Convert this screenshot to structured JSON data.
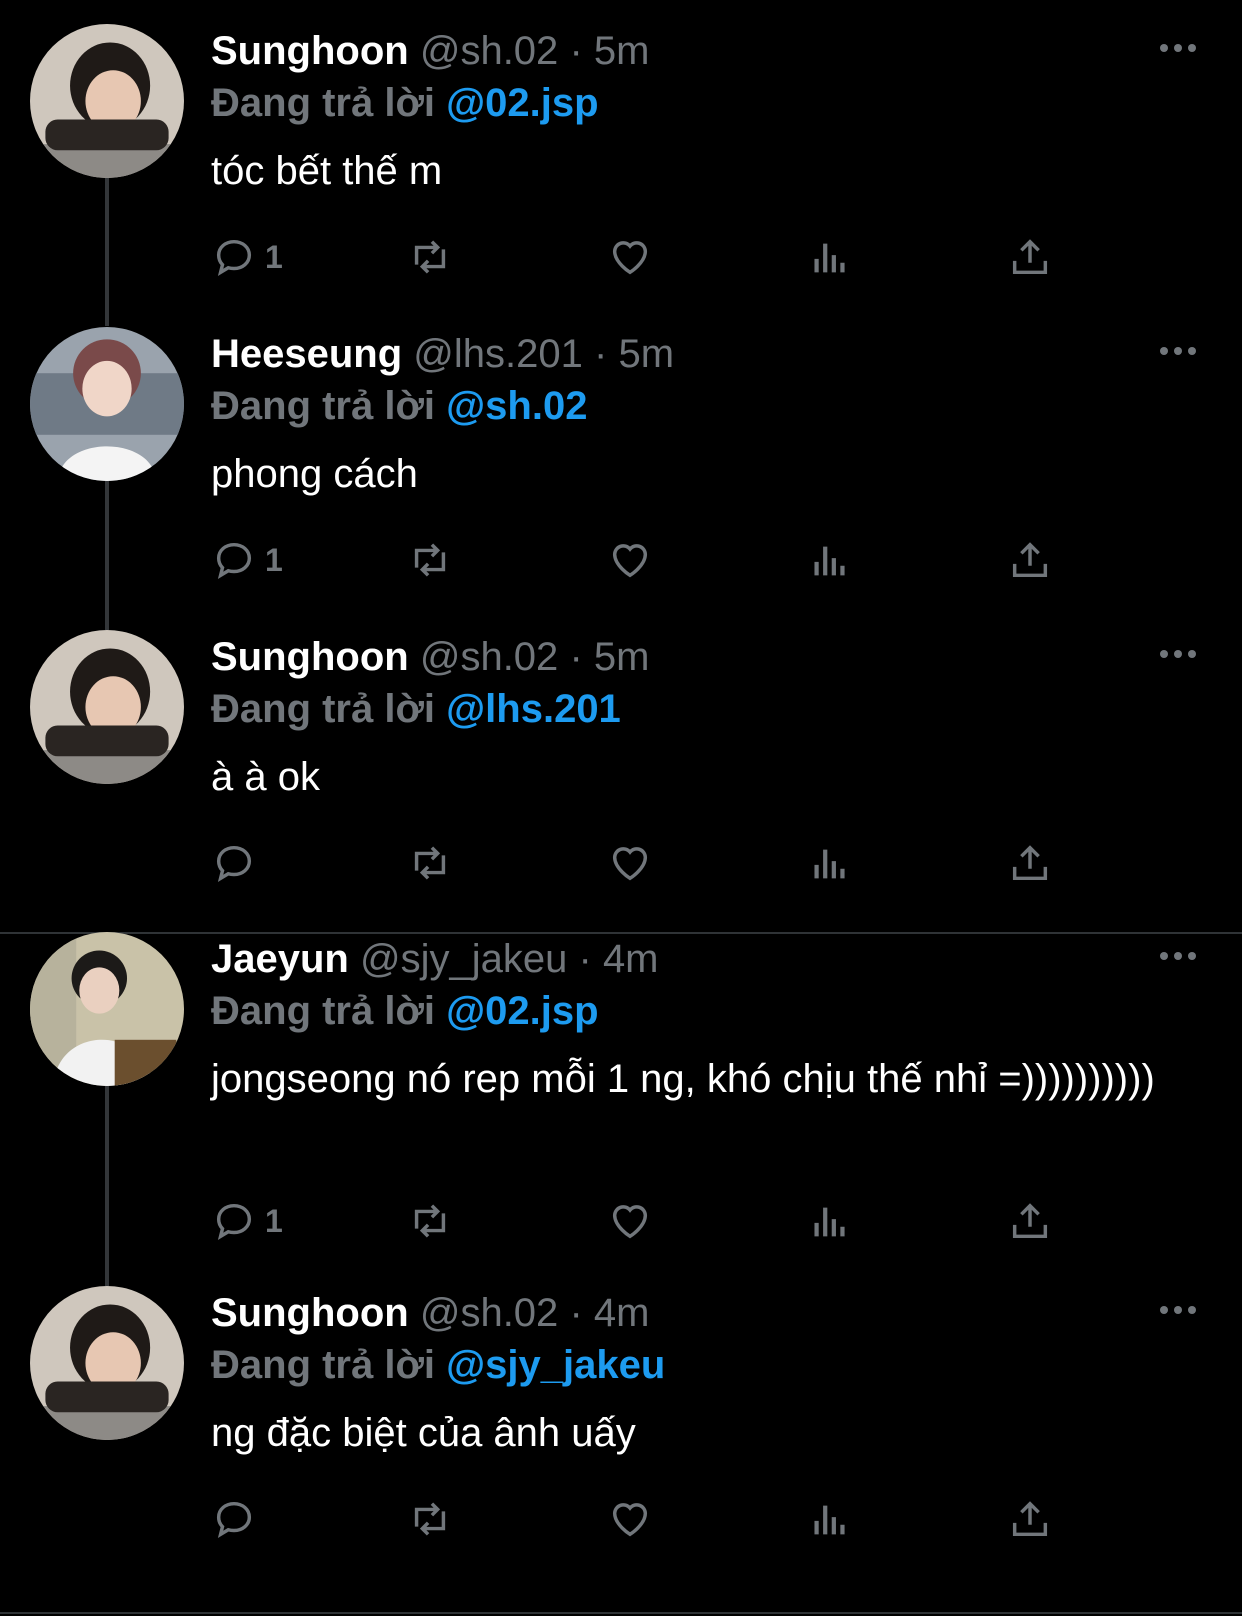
{
  "tweets": [
    {
      "name": "Sunghoon",
      "handle": "@sh.02",
      "time": "5m",
      "replying_label": "Đang trả lời",
      "replying_to": "@02.jsp",
      "text": "tóc bết thế m",
      "reply_count": "1"
    },
    {
      "name": "Heeseung",
      "handle": "@lhs.201",
      "time": "5m",
      "replying_label": "Đang trả lời",
      "replying_to": "@sh.02",
      "text": "phong cách",
      "reply_count": "1"
    },
    {
      "name": "Sunghoon",
      "handle": "@sh.02",
      "time": "5m",
      "replying_label": "Đang trả lời",
      "replying_to": "@lhs.201",
      "text": "à à ok",
      "reply_count": ""
    },
    {
      "name": "Jaeyun",
      "handle": "@sjy_jakeu",
      "time": "4m",
      "replying_label": "Đang trả lời",
      "replying_to": "@02.jsp",
      "text": "jongseong nó rep mỗi 1 ng, khó chịu thế nhỉ =))))))))))",
      "reply_count": "1"
    },
    {
      "name": "Sunghoon",
      "handle": "@sh.02",
      "time": "4m",
      "replying_label": "Đang trả lời",
      "replying_to": "@sjy_jakeu",
      "text": "ng đặc biệt của ânh uấy",
      "reply_count": ""
    }
  ],
  "separator": "·",
  "icons": {
    "reply": "reply-icon",
    "retweet": "retweet-icon",
    "like": "heart-icon",
    "views": "views-icon",
    "share": "share-icon",
    "more": "more-icon"
  },
  "colors": {
    "background": "#000000",
    "text": "#e7e9ea",
    "muted": "#71767b",
    "mention": "#1d9bf0",
    "line": "#333639"
  }
}
